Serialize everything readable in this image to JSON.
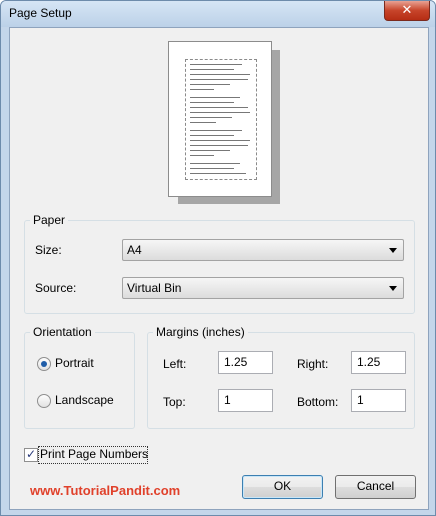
{
  "window": {
    "title": "Page Setup",
    "close_glyph": "✕"
  },
  "preview": {
    "icon": "page-preview-icon"
  },
  "paper": {
    "group_label": "Paper",
    "size_label": "Size:",
    "size_value": "A4",
    "source_label": "Source:",
    "source_value": "Virtual Bin"
  },
  "orientation": {
    "group_label": "Orientation",
    "portrait_label": "Portrait",
    "landscape_label": "Landscape",
    "selected": "Portrait"
  },
  "margins": {
    "group_label": "Margins (inches)",
    "left_label": "Left:",
    "left_value": "1.25",
    "right_label": "Right:",
    "right_value": "1.25",
    "top_label": "Top:",
    "top_value": "1",
    "bottom_label": "Bottom:",
    "bottom_value": "1"
  },
  "print_page_numbers": {
    "label": "Print Page Numbers",
    "checked": true
  },
  "watermark": "www.TutorialPandit.com",
  "buttons": {
    "ok": "OK",
    "cancel": "Cancel"
  },
  "colors": {
    "accent": "#1f5da8",
    "close": "#c7442a",
    "watermark": "#e0412b"
  }
}
